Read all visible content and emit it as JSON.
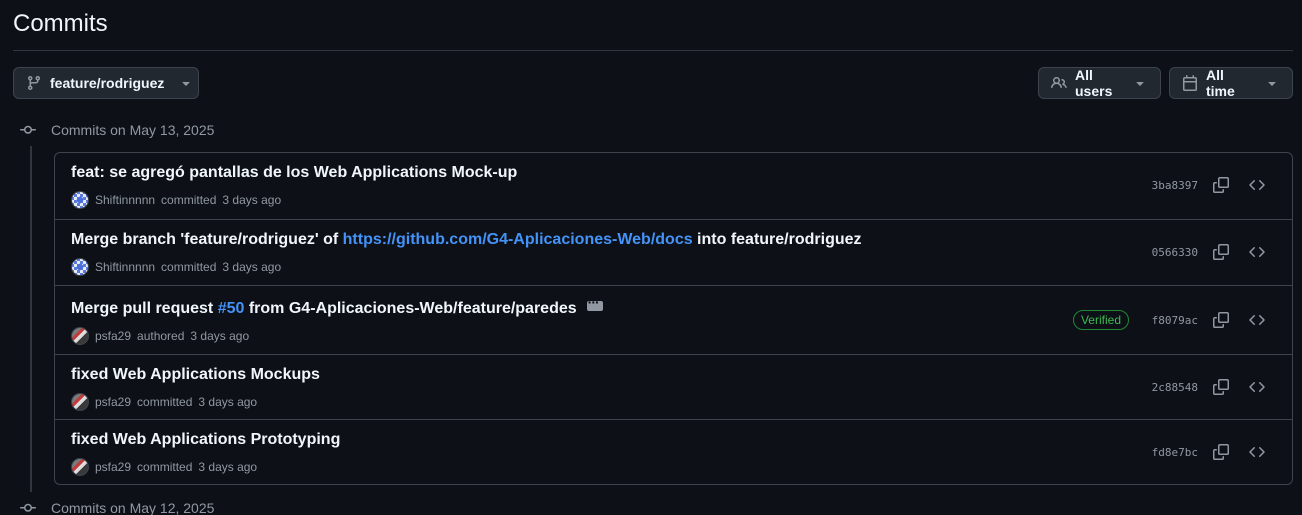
{
  "page": {
    "title": "Commits"
  },
  "toolbar": {
    "branch_label": "feature/rodriguez",
    "users_label": "All users",
    "time_label": "All time"
  },
  "groups": [
    {
      "label": "Commits on May 13, 2025"
    },
    {
      "label": "Commits on May 12, 2025"
    }
  ],
  "commits": [
    {
      "title": "feat: se agregó pantallas de los Web Applications Mock-up",
      "author": "Shiftinnnnn",
      "action": "committed",
      "time": "3 days ago",
      "sha": "3ba8397",
      "verified": false
    },
    {
      "title_prefix": "Merge branch 'feature/rodriguez' of ",
      "title_link": "https://github.com/G4-Aplicaciones-Web/docs",
      "title_suffix": " into feature/rodriguez",
      "author": "Shiftinnnnn",
      "action": "committed",
      "time": "3 days ago",
      "sha": "0566330",
      "verified": false
    },
    {
      "title_prefix": "Merge pull request ",
      "title_link": "#50",
      "title_suffix": " from G4-Aplicaciones-Web/feature/paredes",
      "author": "psfa29",
      "action": "authored",
      "time": "3 days ago",
      "sha": "f8079ac",
      "verified": true,
      "verified_label": "Verified"
    },
    {
      "title": "fixed Web Applications Mockups",
      "author": "psfa29",
      "action": "committed",
      "time": "3 days ago",
      "sha": "2c88548",
      "verified": false
    },
    {
      "title": "fixed Web Applications Prototyping",
      "author": "psfa29",
      "action": "committed",
      "time": "3 days ago",
      "sha": "fd8e7bc",
      "verified": false
    }
  ],
  "colors": {
    "background": "#0d1117",
    "link": "#4493f8",
    "verified": "#3fb950",
    "border": "#3d444d"
  },
  "icons": {
    "branch": "git-branch-icon",
    "users": "people-icon",
    "time": "calendar-icon",
    "caret": "triangle-down-icon",
    "commit": "git-commit-icon",
    "copy": "copy-icon",
    "browse": "code-icon",
    "ellipsis": "kebab-horizontal-icon"
  }
}
